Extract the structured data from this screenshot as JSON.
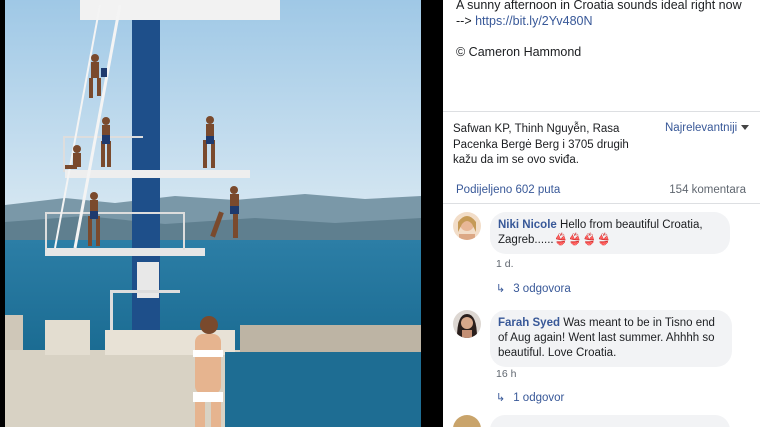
{
  "post": {
    "caption": "A sunny afternoon in Croatia sounds ideal right now",
    "link_prefix": "--> ",
    "link": "https://bit.ly/2Yv480N",
    "credit": "© Cameron Hammond"
  },
  "reactions": {
    "text": "Safwan KP, Thinh Nguyễn, Rasa Pacenka Bergė Berg i 3705 drugih kažu da im se ovo sviđa.",
    "sort_label": "Najrelevantniji"
  },
  "stats": {
    "shares": "Podijeljeno 602 puta",
    "comments": "154 komentara"
  },
  "comments": [
    {
      "author": "Niki Nicole",
      "text": " Hello from beautiful Croatia, Zagreb......",
      "emoji": "👙👙👙👙",
      "time": "1 d.",
      "replies": "3 odgovora"
    },
    {
      "author": "Farah Syed",
      "text": " Was meant to be in Tisno end of Aug again! Went last summer. Ahhhh so beautiful. Love Croatia.",
      "time": "16 h",
      "replies": "1 odgovor"
    }
  ],
  "colors": {
    "link": "#385898",
    "text": "#1c1e21",
    "muted": "#606770",
    "sea": "#1f6f96",
    "sky": "#bcd9ec"
  }
}
